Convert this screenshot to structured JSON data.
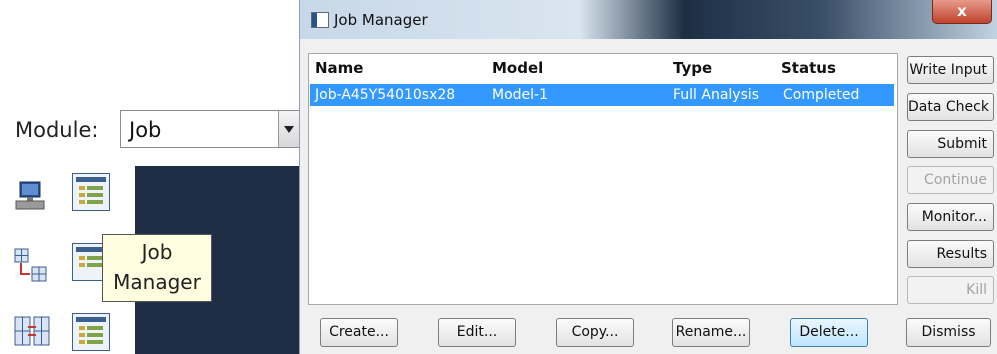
{
  "module": {
    "label": "Module:",
    "value": "Job"
  },
  "toolbox": {
    "icons": [
      "computer-icon",
      "job-manager-icon",
      "mesh-arrow-icon",
      "job-manager-icon",
      "mesh-pair-icon",
      "job-manager-icon"
    ],
    "tooltip_line1": "Job",
    "tooltip_line2": "Manager"
  },
  "dialog": {
    "title": "Job Manager",
    "close_label": "x",
    "columns": {
      "name": "Name",
      "model": "Model",
      "type": "Type",
      "status": "Status"
    },
    "rows": [
      {
        "name": "Job-A45Y54010sx28",
        "model": "Model-1",
        "type": "Full Analysis",
        "status": "Completed"
      }
    ],
    "side_buttons": {
      "write_input": "Write Input",
      "data_check": "Data Check",
      "submit": "Submit",
      "continue": "Continue",
      "monitor": "Monitor...",
      "results": "Results",
      "kill": "Kill"
    },
    "bottom_buttons": {
      "create": "Create...",
      "edit": "Edit...",
      "copy": "Copy...",
      "rename": "Rename...",
      "delete": "Delete...",
      "dismiss": "Dismiss"
    }
  },
  "colors": {
    "selection": "#3399ff",
    "canvas": "#1f2e45",
    "tooltip": "#fffee1"
  }
}
